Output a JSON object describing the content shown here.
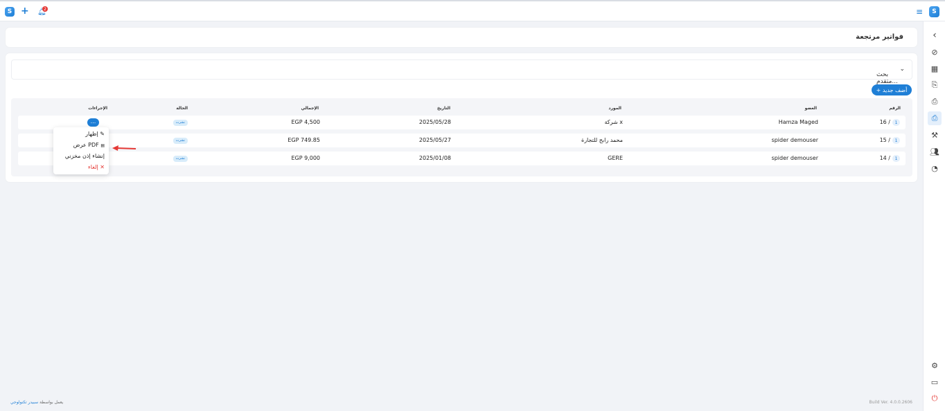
{
  "topbar": {
    "logo_glyph": "S",
    "add_icon": "plus-icon",
    "bell_icon": "bell-icon",
    "bell_count": "2",
    "menu_icon": "hamburger-icon"
  },
  "rail": {
    "items": [
      "chevron-left-icon",
      "sales-icon",
      "store-icon",
      "invoice-icon",
      "returns-icon",
      "returned-invoice-icon",
      "tools-icon",
      "users-icon",
      "reports-icon",
      "settings-icon",
      "window-icon",
      "power-icon"
    ]
  },
  "page": {
    "title": "فواتير مرتجعة"
  },
  "search": {
    "label": "بحث متقدم..."
  },
  "add_button": {
    "label": "+ أضف جديد"
  },
  "table": {
    "headers": {
      "number": "الرقم",
      "member": "العضو",
      "supplier": "المورد",
      "date": "التاريخ",
      "total": "الإجمالي",
      "status": "الحالة",
      "actions": "الإجراءات"
    },
    "rows": [
      {
        "badge": "1",
        "number": "16 /",
        "member": "Hamza Maged",
        "supplier": "شركة x",
        "date": "2025/05/28",
        "total": "EGP 4,500",
        "status": "نشرت"
      },
      {
        "badge": "1",
        "number": "15 /",
        "member": "spider demouser",
        "supplier": "محمد رابح للتجارة",
        "date": "2025/05/27",
        "total": "EGP 749.85",
        "status": "نشرت"
      },
      {
        "badge": "1",
        "number": "14 /",
        "member": "spider demouser",
        "supplier": "GERE",
        "date": "2025/01/08",
        "total": "EGP 9,000",
        "status": "نشرت"
      }
    ],
    "actions_label": "..."
  },
  "menu": {
    "show": "إظهار",
    "pdf": "عرض PDF",
    "warehouse": "إنشاء إذن مخزني",
    "cancel": "إلغاء"
  },
  "footer": {
    "powered_by": "يعمل بواسطة",
    "brand": "سبيدر تكنولوجي",
    "build": "Build Ver. 4.0.0.2606"
  },
  "colors": {
    "accent": "#1f7fd6",
    "danger": "#e53935",
    "annotation_arrow": "#e53935"
  }
}
